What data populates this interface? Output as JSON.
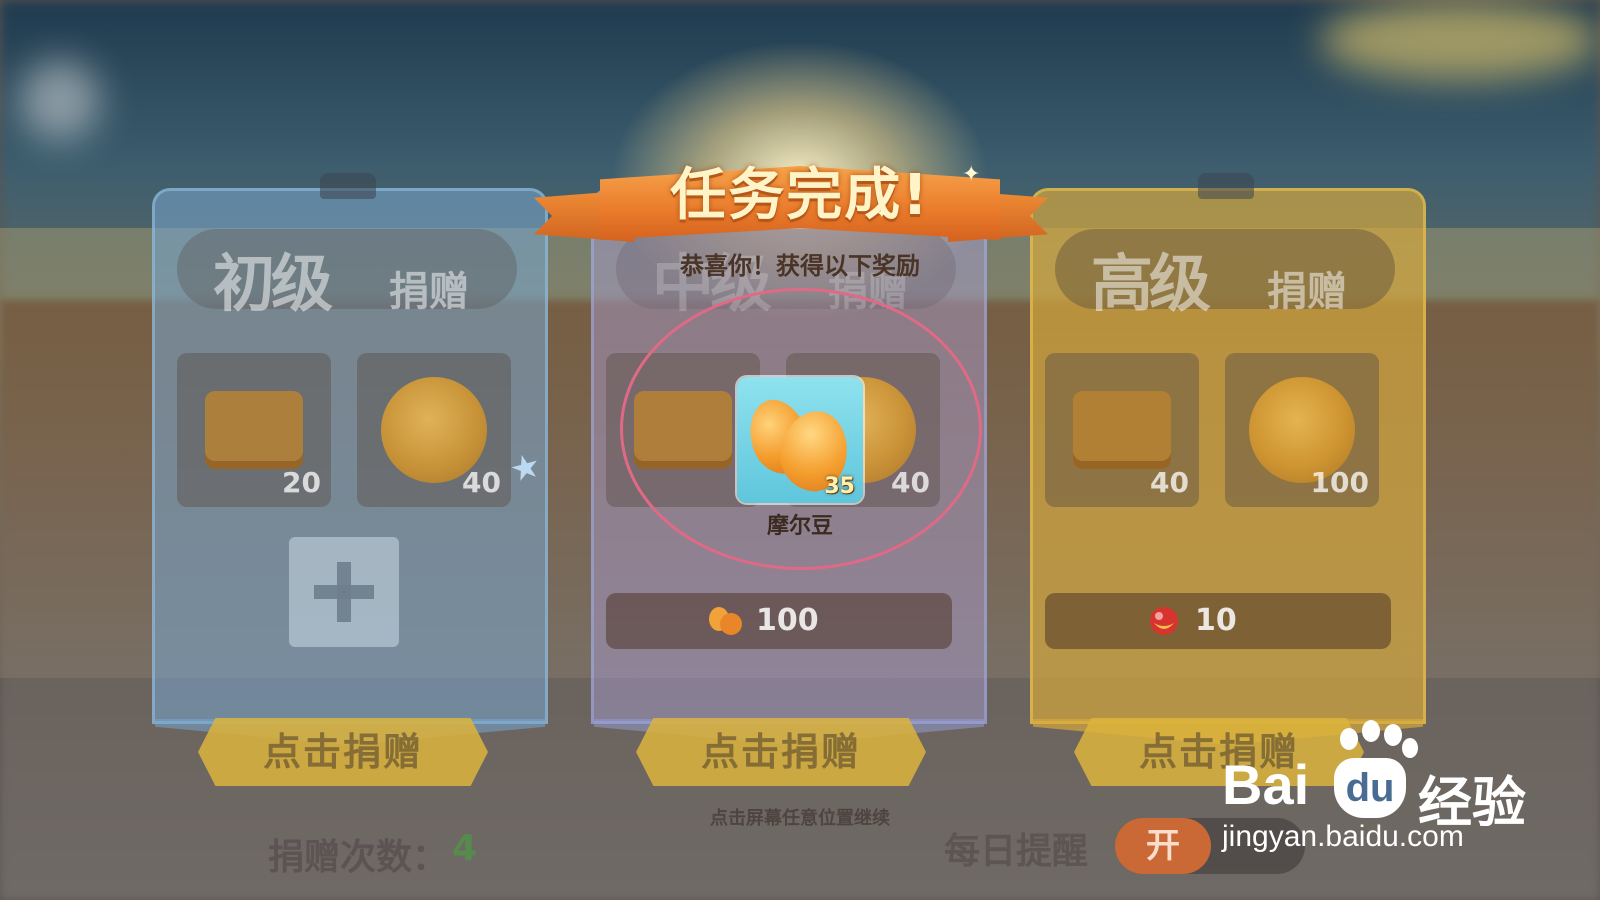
{
  "popup": {
    "title": "任务完成!",
    "subtitle": "恭喜你！获得以下奖励",
    "reward": {
      "icon": "mole-bean-icon",
      "name": "摩尔豆",
      "quantity": "35"
    },
    "continue_hint": "点击屏幕任意位置继续",
    "highlight_color": "#e06a86"
  },
  "cards": [
    {
      "title_big": "初级",
      "title_small": "捐赠",
      "color": "blue",
      "items": [
        {
          "icon": "treasure-chest-icon",
          "count": "20"
        },
        {
          "icon": "gold-coin-icon",
          "count": "40"
        }
      ],
      "donate_label": "点击捐赠"
    },
    {
      "title_big": "中级",
      "title_small": "捐赠",
      "color": "purple",
      "items": [
        {
          "icon": "treasure-chest-icon",
          "count": ""
        },
        {
          "icon": "gold-coin-icon",
          "count": "40"
        }
      ],
      "cost": {
        "icon": "mole-bean-icon",
        "value": "100"
      },
      "donate_label": "点击捐赠"
    },
    {
      "title_big": "高级",
      "title_small": "捐赠",
      "color": "gold",
      "items": [
        {
          "icon": "treasure-chest-icon",
          "count": "40"
        },
        {
          "icon": "gold-coin-icon",
          "count": "100"
        }
      ],
      "cost": {
        "icon": "red-gem-icon",
        "value": "10"
      },
      "donate_label": "点击捐赠"
    }
  ],
  "footer": {
    "donate_count_label": "捐赠次数：",
    "donate_count_value": "4",
    "daily_reminder_label": "每日提醒",
    "toggle_state": "开"
  },
  "watermark": {
    "brand_left": "Bai",
    "brand_mid": "du",
    "brand_right": "经验",
    "url": "jingyan.baidu.com"
  }
}
